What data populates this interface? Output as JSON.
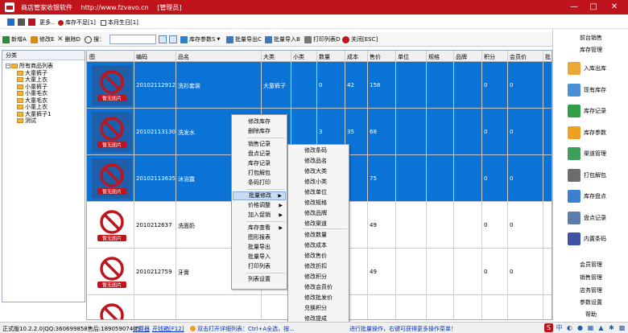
{
  "titlebar": {
    "app_name": "商店管家收银软件",
    "url": "http://www.fzvavo.cn",
    "role": "[管理员]",
    "minimize": "—",
    "maximize": "□",
    "close": "✕"
  },
  "infobar": {
    "more": "更多..",
    "stock_alert": "库存不足[1]",
    "birthday": "本月生日[1]",
    "swatch_colors": [
      "#1f6fc6",
      "#555555",
      "#c0141c"
    ]
  },
  "toolbar": {
    "new": "新增A",
    "edit": "修改E",
    "delete": "删除D",
    "search_label": "搜：",
    "search_value": "",
    "stock_params": "库存参数S",
    "batch_export": "批量导出C",
    "batch_import": "批量导入B",
    "print_list": "打印列表D",
    "close_esc": "关闭[ESC]"
  },
  "category": {
    "header": "分类",
    "items": [
      {
        "label": "所有商品列表",
        "level": 0
      },
      {
        "label": "大童裤子",
        "level": 1
      },
      {
        "label": "大童上衣",
        "level": 1
      },
      {
        "label": "小童裤子",
        "level": 1
      },
      {
        "label": "小童毛衣",
        "level": 1
      },
      {
        "label": "大童毛衣",
        "level": 1
      },
      {
        "label": "小童上衣",
        "level": 1
      },
      {
        "label": "大童裤子1",
        "level": 1
      },
      {
        "label": "测试",
        "level": 1
      }
    ]
  },
  "grid": {
    "columns": [
      "图",
      "编码",
      "品名",
      "大类",
      "小类",
      "数量",
      "成本",
      "售价",
      "单位",
      "规格",
      "品牌",
      "积分",
      "会员价",
      "批"
    ],
    "no_image_label": "暂无图片",
    "rows": [
      {
        "code": "20102112912",
        "name": "洗衫套装",
        "cat": "大童裤子",
        "qty": "0",
        "cost": "42",
        "price": "158",
        "points": "0",
        "member": "0",
        "selected": true
      },
      {
        "code": "20102113130",
        "name": "洗发水",
        "cat": "",
        "qty": "3",
        "cost": "35",
        "price": "68",
        "points": "0",
        "member": "0",
        "selected": true
      },
      {
        "code": "20102113635",
        "name": "沐浴露",
        "cat": "",
        "qty": "",
        "cost": "",
        "price": "75",
        "points": "0",
        "member": "0",
        "selected": true
      },
      {
        "code": "2010212637",
        "name": "洗面奶",
        "cat": "",
        "qty": "",
        "cost": "",
        "price": "49",
        "points": "0",
        "member": "0",
        "selected": false
      },
      {
        "code": "2010212759",
        "name": "牙膏",
        "cat": "",
        "qty": "",
        "cost": "",
        "price": "49",
        "points": "0",
        "member": "0",
        "selected": false
      },
      {
        "code": "",
        "name": "",
        "cat": "",
        "qty": "",
        "cost": "",
        "price": "",
        "points": "",
        "member": "",
        "selected": false
      }
    ]
  },
  "context_menu": {
    "items": [
      "修改库存",
      "删除库存",
      "销售记录",
      "盘点记录",
      "库存记录",
      "打包解包",
      "条码打印",
      "批量修改",
      "价格调整",
      "加入促销",
      "库存查看",
      "图形报表",
      "批量导出",
      "批量导入",
      "打印列表",
      "列表设置"
    ],
    "submenu_arrow": "▶"
  },
  "submenu": {
    "items": [
      "修改条码",
      "修改品名",
      "修改大类",
      "修改小类",
      "修改单位",
      "修改规格",
      "修改品牌",
      "修改渠道",
      "修改数量",
      "修改成本",
      "修改售价",
      "修改折扣",
      "修改积分",
      "修改会员价",
      "修改批发价",
      "兑换积分",
      "修改提成",
      "最低库存"
    ]
  },
  "right_panel": {
    "top_links": [
      "前台销售",
      "库存管理"
    ],
    "buttons": [
      {
        "label": "入库出库",
        "icon": "folder-in-icon",
        "color": "#e8a936"
      },
      {
        "label": "现有库存",
        "icon": "house-icon",
        "color": "#4a8fd8"
      },
      {
        "label": "库存记录",
        "icon": "arrows-icon",
        "color": "#2f9e44"
      },
      {
        "label": "库存参数",
        "icon": "sliders-icon",
        "color": "#f0a020"
      },
      {
        "label": "渠道管理",
        "icon": "box-icon",
        "color": "#3aa05a"
      },
      {
        "label": "打包解包",
        "icon": "package-icon",
        "color": "#6d6d6d"
      },
      {
        "label": "库存盘点",
        "icon": "clipboard-icon",
        "color": "#3a7fd0"
      },
      {
        "label": "盘点记录",
        "icon": "magnifier-icon",
        "color": "#5c7cae"
      },
      {
        "label": "内置条码",
        "icon": "cursor-icon",
        "color": "#3f51a8"
      }
    ],
    "bottom_links": [
      "会员管理",
      "销售管理",
      "店务管理",
      "参数设置",
      "帮助"
    ]
  },
  "statusbar": {
    "version": "正式版10.2.2.0|QQ:360699858售后:18905907405",
    "calculator": "计算器",
    "cashbox": "开钱箱[F12]",
    "tip": "双击打开详细列表：Ctrl+A全选，按...",
    "tip2": "进行批量操作，右键可获得更多操作菜单！"
  }
}
